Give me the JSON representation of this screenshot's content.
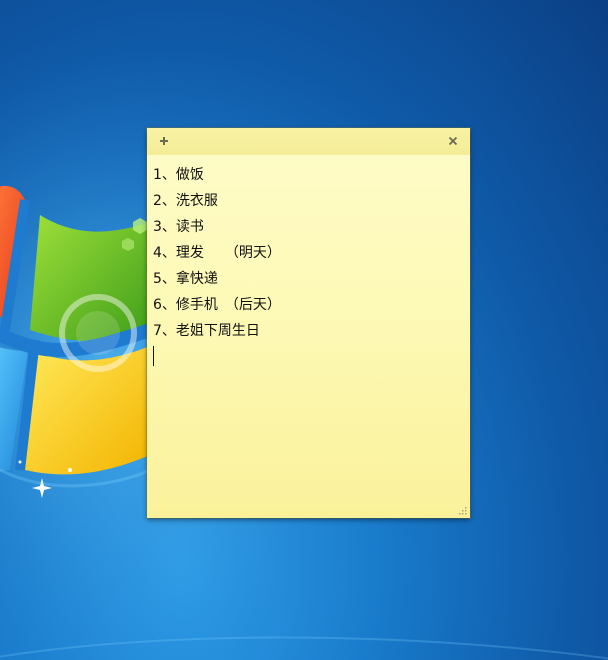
{
  "desktop": {
    "background_color": "#1466b8",
    "wallpaper": "windows-7-flag-logo"
  },
  "sticky_note": {
    "background_color": "#fdf9b5",
    "new_note_icon": "plus-icon",
    "close_icon": "close-icon",
    "resize_icon": "resize-grip-icon",
    "lines": [
      "1、做饭",
      "2、洗衣服",
      "3、读书",
      "4、理发　　（明天）",
      "5、拿快递",
      "6、修手机　（后天）",
      "7、老姐下周生日"
    ]
  }
}
